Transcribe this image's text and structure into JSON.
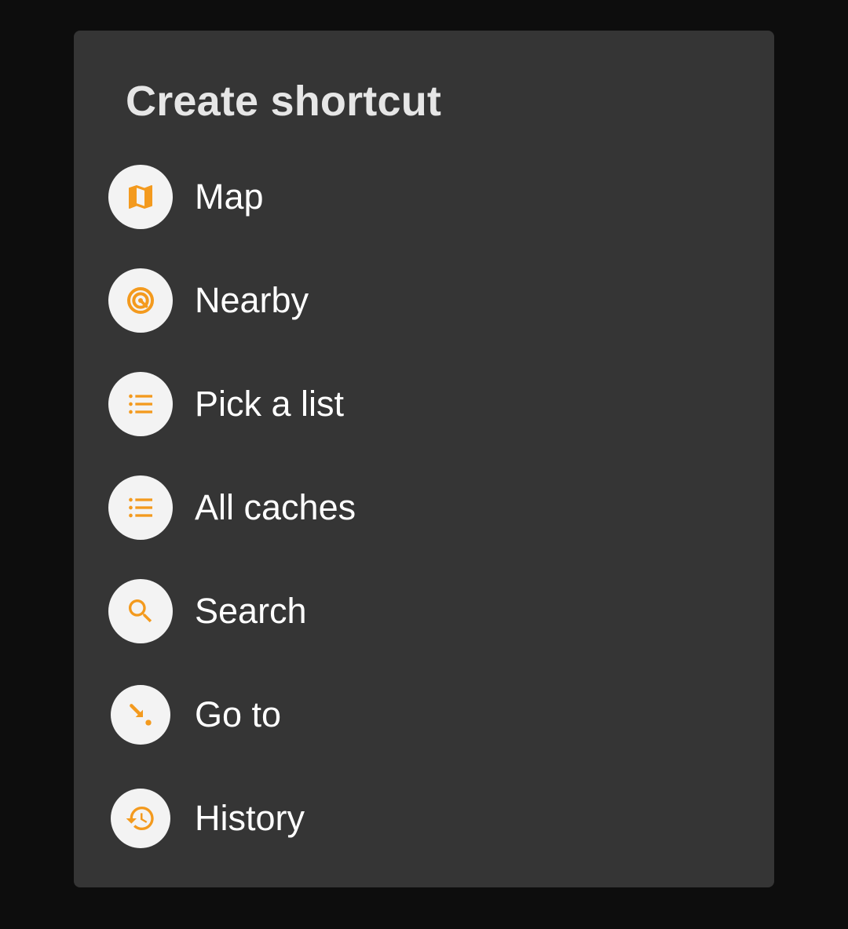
{
  "dialog": {
    "title": "Create shortcut",
    "accent_color": "#f39a1e",
    "items": [
      {
        "label": "Map",
        "icon": "map-icon"
      },
      {
        "label": "Nearby",
        "icon": "target-icon"
      },
      {
        "label": "Pick a list",
        "icon": "list-icon"
      },
      {
        "label": "All caches",
        "icon": "list-icon"
      },
      {
        "label": "Search",
        "icon": "search-icon"
      },
      {
        "label": "Go to",
        "icon": "arrow-to-point-icon"
      },
      {
        "label": "History",
        "icon": "history-icon"
      }
    ]
  }
}
